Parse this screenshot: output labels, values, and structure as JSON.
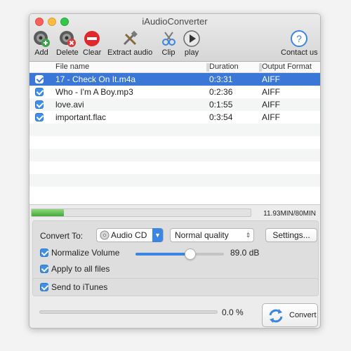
{
  "window": {
    "title": "iAudioConverter"
  },
  "toolbar": {
    "add": "Add",
    "delete": "Delete",
    "clear": "Clear",
    "extract_audio": "Extract audio",
    "clip": "Clip",
    "play": "play",
    "contact_us": "Contact us"
  },
  "icons": {
    "add": "speaker-plus-icon",
    "delete": "speaker-delete-icon",
    "clear": "no-entry-icon",
    "extract_audio": "tools-icon",
    "clip": "clip-icon",
    "play": "play-icon",
    "contact_us": "question-icon",
    "convert": "sync-arrows-icon"
  },
  "columns": [
    "File name",
    "Duration",
    "Output Format"
  ],
  "files": [
    {
      "name": "17 - Check On It.m4a",
      "duration": "0:3:31",
      "format": "AIFF",
      "checked": true,
      "selected": true
    },
    {
      "name": "Who - I'm A Boy.mp3",
      "duration": "0:2:36",
      "format": "AIFF",
      "checked": true,
      "selected": false
    },
    {
      "name": "love.avi",
      "duration": "0:1:55",
      "format": "AIFF",
      "checked": true,
      "selected": false
    },
    {
      "name": "important.flac",
      "duration": "0:3:54",
      "format": "AIFF",
      "checked": true,
      "selected": false
    }
  ],
  "storage": {
    "text": "11.93MIN/80MIN",
    "fill_fraction": 0.149
  },
  "settings": {
    "convert_to_label": "Convert To:",
    "format_value": "Audio CD",
    "quality_value": "Normal quality",
    "settings_button": "Settings...",
    "normalize_label": "Normalize Volume",
    "normalize_checked": true,
    "volume_value": "89.0 dB",
    "volume_fraction": 0.62,
    "apply_all_label": "Apply to all files",
    "apply_all_checked": true,
    "send_itunes_label": "Send to iTunes",
    "send_itunes_checked": true
  },
  "conversion": {
    "progress_text": "0.0 %",
    "progress_fraction": 0.0,
    "convert_label": "Convert"
  },
  "colors": {
    "accent": "#3b86e3",
    "selection": "#3b77d7",
    "storage_fill": "#45a83a"
  }
}
